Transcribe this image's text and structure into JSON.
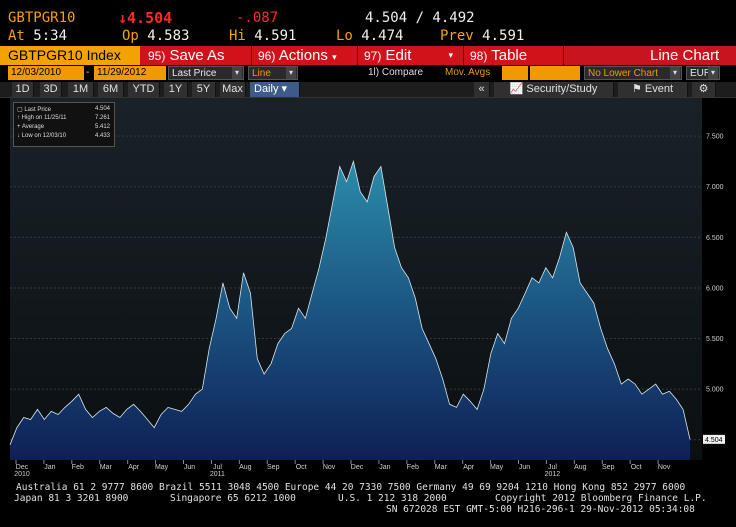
{
  "quote": {
    "ticker": "GBTPGR10",
    "last": "4.504",
    "change": "-.087",
    "bid_ask": "4.504 / 4.492",
    "at_label": "At",
    "at_time": "5:34",
    "open_label": "Op",
    "open": "4.583",
    "high_label": "Hi",
    "high": "4.591",
    "low_label": "Lo",
    "low": "4.474",
    "prev_label": "Prev",
    "prev": "4.591"
  },
  "toolbar": {
    "index_label": "GBTPGR10 Index",
    "save_num": "95)",
    "save_label": "Save As",
    "actions_num": "96)",
    "actions_label": "Actions",
    "edit_num": "97)",
    "edit_label": "Edit",
    "table_num": "98)",
    "table_label": "Table",
    "chart_type": "Line Chart"
  },
  "settings": {
    "start_date": "12/03/2010",
    "end_date": "11/29/2012",
    "field": "Last Price",
    "style": "Line",
    "compare": "1l) Compare",
    "mov_avgs": "Mov. Avgs",
    "lower_chart": "No Lower Chart",
    "currency": "EUR"
  },
  "ranges": [
    "1D",
    "3D",
    "1M",
    "6M",
    "YTD",
    "1Y",
    "5Y",
    "Max"
  ],
  "period": "Daily",
  "security_study": "Security/Study",
  "event": "Event",
  "legend": {
    "last_label": "Last Price",
    "last_value": "4.504",
    "high_label": "High on 11/25/11",
    "high_value": "7.261",
    "avg_label": "Average",
    "avg_value": "5.412",
    "low_label": "Low on 12/03/10",
    "low_value": "4.433"
  },
  "chart_data": {
    "type": "area",
    "x_labels": [
      "Dec",
      "Jan",
      "Feb",
      "Mar",
      "Apr",
      "May",
      "Jun",
      "Jul",
      "Aug",
      "Sep",
      "Oct",
      "Nov",
      "Dec",
      "Jan",
      "Feb",
      "Mar",
      "Apr",
      "May",
      "Jun",
      "Jul",
      "Aug",
      "Sep",
      "Oct",
      "Nov"
    ],
    "year_labels": [
      {
        "after": "Dec",
        "text": "2010"
      },
      {
        "after": "Jul",
        "text": "2011"
      },
      {
        "after": "Jul",
        "text": "2012"
      }
    ],
    "y_ticks": [
      "7.500",
      "7.000",
      "6.500",
      "6.000",
      "5.500",
      "5.000",
      "4.500"
    ],
    "ylim": [
      4.3,
      7.6
    ],
    "last_value_label": "4.504",
    "values": [
      4.45,
      4.62,
      4.72,
      4.7,
      4.8,
      4.7,
      4.78,
      4.75,
      4.82,
      4.88,
      4.95,
      4.8,
      4.72,
      4.78,
      4.82,
      4.76,
      4.72,
      4.8,
      4.85,
      4.78,
      4.7,
      4.62,
      4.75,
      4.82,
      4.8,
      4.78,
      4.85,
      4.95,
      5.0,
      5.4,
      5.7,
      6.05,
      5.8,
      5.7,
      6.15,
      5.95,
      5.3,
      5.15,
      5.25,
      5.45,
      5.55,
      5.6,
      5.8,
      5.7,
      5.95,
      6.2,
      6.5,
      6.85,
      7.2,
      7.05,
      7.25,
      6.95,
      6.85,
      7.1,
      7.2,
      6.8,
      6.4,
      6.2,
      6.1,
      5.9,
      5.6,
      5.45,
      5.3,
      5.1,
      4.85,
      4.82,
      4.95,
      4.88,
      4.8,
      5.0,
      5.35,
      5.55,
      5.45,
      5.7,
      5.8,
      5.95,
      6.1,
      6.05,
      6.2,
      6.1,
      6.3,
      6.55,
      6.4,
      6.05,
      5.95,
      5.85,
      5.6,
      5.4,
      5.25,
      5.05,
      5.1,
      5.05,
      4.95,
      5.0,
      5.05,
      4.95,
      4.98,
      4.9,
      4.8,
      4.504
    ],
    "x_range": [
      "12/03/2010",
      "11/29/2012"
    ],
    "grid": true
  },
  "footer": {
    "line1": "Australia 61 2 9777 8600 Brazil 5511 3048 4500 Europe 44 20 7330 7500 Germany 49 69 9204 1210 Hong Kong 852 2977 6000",
    "line2a": "Japan 81 3 3201 8900",
    "line2b": "Singapore 65 6212 1000",
    "line2c": "U.S. 1 212 318 2000",
    "line2d": "Copyright 2012 Bloomberg Finance L.P.",
    "line3": "SN 672028 EST  GMT-5:00 H216-296-1 29-Nov-2012 05:34:08"
  }
}
